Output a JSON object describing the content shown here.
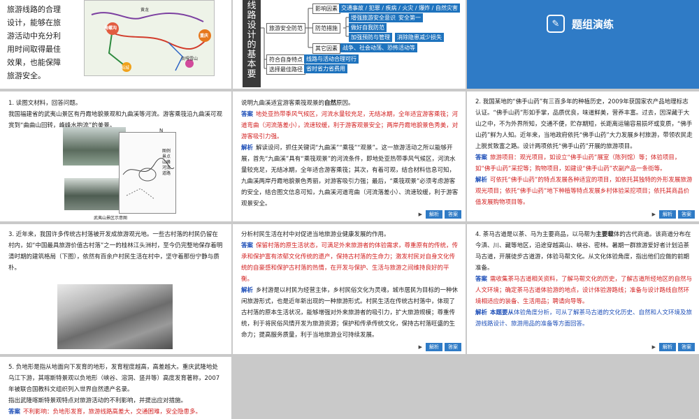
{
  "s1": {
    "lines": [
      "旅游线路的合理",
      "设计，能够在旅",
      "游活动中充分利",
      "用时间取得最佳",
      "效果，也能保障",
      "旅游安全。"
    ],
    "map_labels": [
      "海螺沟",
      "重庆",
      "黄龙",
      "贡嘎雪山",
      "稻城"
    ]
  },
  "s2": {
    "vertical_title": [
      "线",
      "路",
      "设",
      "计",
      "的",
      "基",
      "本",
      "要"
    ],
    "nodes": {
      "influence": "影响因素",
      "influence_val": "交通事故 / 犯罪 / 疾病 / 火灾 / 爆炸 / 自然灾害",
      "safety": "旅游安全防范",
      "measures": "防范措施",
      "m1": "增强旅游安全意识",
      "m1b": "安全第一",
      "m2": "做好自我防范",
      "m3": "加强预防与管理",
      "m3b": "消除隐患减少损失",
      "other": "其它因素",
      "other_val": "战争、社会动荡、恐怖活动等",
      "fit": "符合自身特点",
      "fit_val": "线路与活动合理可行",
      "best": "选择最佳路径",
      "best_val": "省时省力省费用"
    }
  },
  "s3": {
    "title": "题组演练",
    "icon": "pencil-icon"
  },
  "q1": {
    "text": "1. 读图文材料，回答问题。",
    "text2": "我国福建省的武夷山景区有丹霞地貌景观和九曲溪等河流。游客乘筏沿九曲溪可观赏到“曲曲山回转，峰峰水抱流”的美景。",
    "legend_title": "图例",
    "legend": [
      "景点",
      "山峰",
      "河流",
      "道路"
    ],
    "map_caption": "武夷山景区示意图",
    "north": "N"
  },
  "q1b": {
    "question_a": "说明九曲溪适宜游客乘筏观景的",
    "question_b": "原因。",
    "question_bold": "自然",
    "answer_label": "答案",
    "answer": "地处亚热带季风气候区，河流水量较充足，无结冰期，全年适宜游客乘筏；河道弯曲（河流落差小），流速较缓，利于游客观景安全；两岸丹霞地貌景色秀美，对游客吸引力强。",
    "analysis_label": "解析",
    "analysis": "解读设问，抓住关键词“九曲溪”“乘筏”“观景”。这一旅游活动之所以能够开展，首先“九曲溪”具有“乘筏观景”的河流条件，即地处亚热带季风气候区，河流水量较充足，无结冰期，全年适合游客乘筏；其次，有着可观，结合材料信息可知，九曲溪两岸丹霞地貌景色秀丽，对游客吸引力强；最后，“乘筏观景”必须考虑游客的安全，结合图文信息可知，九曲溪河道弯曲（河流落差小）、流速较缓，利于游客观景安全。",
    "btn1": "解析",
    "btn2": "答案"
  },
  "q2": {
    "text": "2. 我国某地的“佛手山药”有三百多年的种植历史，2009年获国家农产品地理标志认证。“佛手山药”形如手掌，品质优良，味道鲜美，营养丰富。过去，因深藏于大山之中，不为外界所知，交通不便，贮存期短，长距离运输容易损坏或变质，“佛手山药”鲜为人知。近年来，当地政府依托“佛手山药”大力发展乡村旅游，带领农民走上脱贫致富之路。设计两项依托“佛手山药”开展的旅游项目。",
    "answer_label": "答案",
    "answer": "旅游项目：观光项目，如设立“佛手山药”展室（陈列馆）等；体验项目，如“佛手山药”采挖等；购物项目，如建设“佛手山药”农副产品一条街等。",
    "analysis_label": "解析",
    "analysis": "可依托“佛手山药”的特点发展各种适宜的项目，如依托其独特的外形发展旅游观光项目；依托“佛手山药”地下种植等特点发展乡村体验采挖项目；依托其商品价值发展购物项目等。",
    "btn1": "解析",
    "btn2": "答案"
  },
  "q3": {
    "text": "3. 近年来，我国许多传统古村落被开发成旅游观光地。一些古村落的村民仍留在村内，如“中国最具旅游价值古村落”之一的桂林江头洲村，至今仍完整地保存着明清时期的建筑格局（下图），依然有百余户村民生活在村中，坚守着那份宁静与质朴。"
  },
  "q3b": {
    "question": "分析村民生活在村中对促进当地旅游业健康发展的作用。",
    "answer_label": "答案",
    "answer": "保留村落的原生活状态，可满足外来旅游者的体验需求，尊重原有的传统，传承和保护富有浓郁文化传统的遗产，保持古村落的生命力；激发村民对自身文化传统的自豪感和保护古村落的热情，在开发与保护、生活与旅游之间维持良好的平衡。",
    "analysis_label": "解析",
    "analysis": "乡村游是以村民为经营主体，乡村民俗文化为灵魂，城市居民为目标的一种休闲旅游形式，也是近年新出现的一种旅游形式。村民生活在传统古村落中，体现了古村落的原本生活状况，能够增强对外来旅游者的吸引力，扩大旅游规模；尊重传统，利于将民俗风情开发为旅游资源；保护和传承传统文化，保持古村落旺盛的生命力；提高服务质量，利于当地旅游业可持续发展。",
    "btn1": "解析",
    "btn2": "答案"
  },
  "q4": {
    "text_a": "4. 茶马古道是以茶、马为主要商品，以马帮为",
    "text_bold": "主要载",
    "text_b": "体的古代商道。该商道分布在今滇、川、藏等地区，沿途穿越高山、峡谷、密林。暑期一群旅游爱好者计划沿茶马古道，开展徒步古道游，体验马帮文化。从文化体验角度，指出他们应做的前期准备。",
    "answer_label": "答案",
    "answer": "需收集茶马古道相关资料，了解马帮文化的历史，了解古道所经地区的自然与人文环境；确定茶马古道体验游的地点，设计体验游路线；准备与设计路线自然环境相适应的装备、生活用品；聘请向导等。",
    "analysis_label": "解析",
    "analysis_bold": "本题要从",
    "analysis": "体验角度分析，可从了解茶马古道的文化历史、自然和人文环境及旅游线路设计、旅游用品的准备等方面回答。",
    "btn1": "解析",
    "btn2": "答案"
  },
  "q5": {
    "text": "5. 负地形是指从地面向下发育的地形，发育程度越高，高差越大。重庆武隆地处乌江下游，其喀斯特景观以负地形（峡谷、溶洞、竖井等）高度发育著称，2007年被联合国教科文组织列入世界自然遗产名录。",
    "text2": "指出武隆喀斯特景观特点对旅游活动的不利影响，并提出应对措施。",
    "answer_label": "答案",
    "answer": "不利影响：负地形发育，旅游线路高差大，交通困难，安全隐患多。"
  }
}
